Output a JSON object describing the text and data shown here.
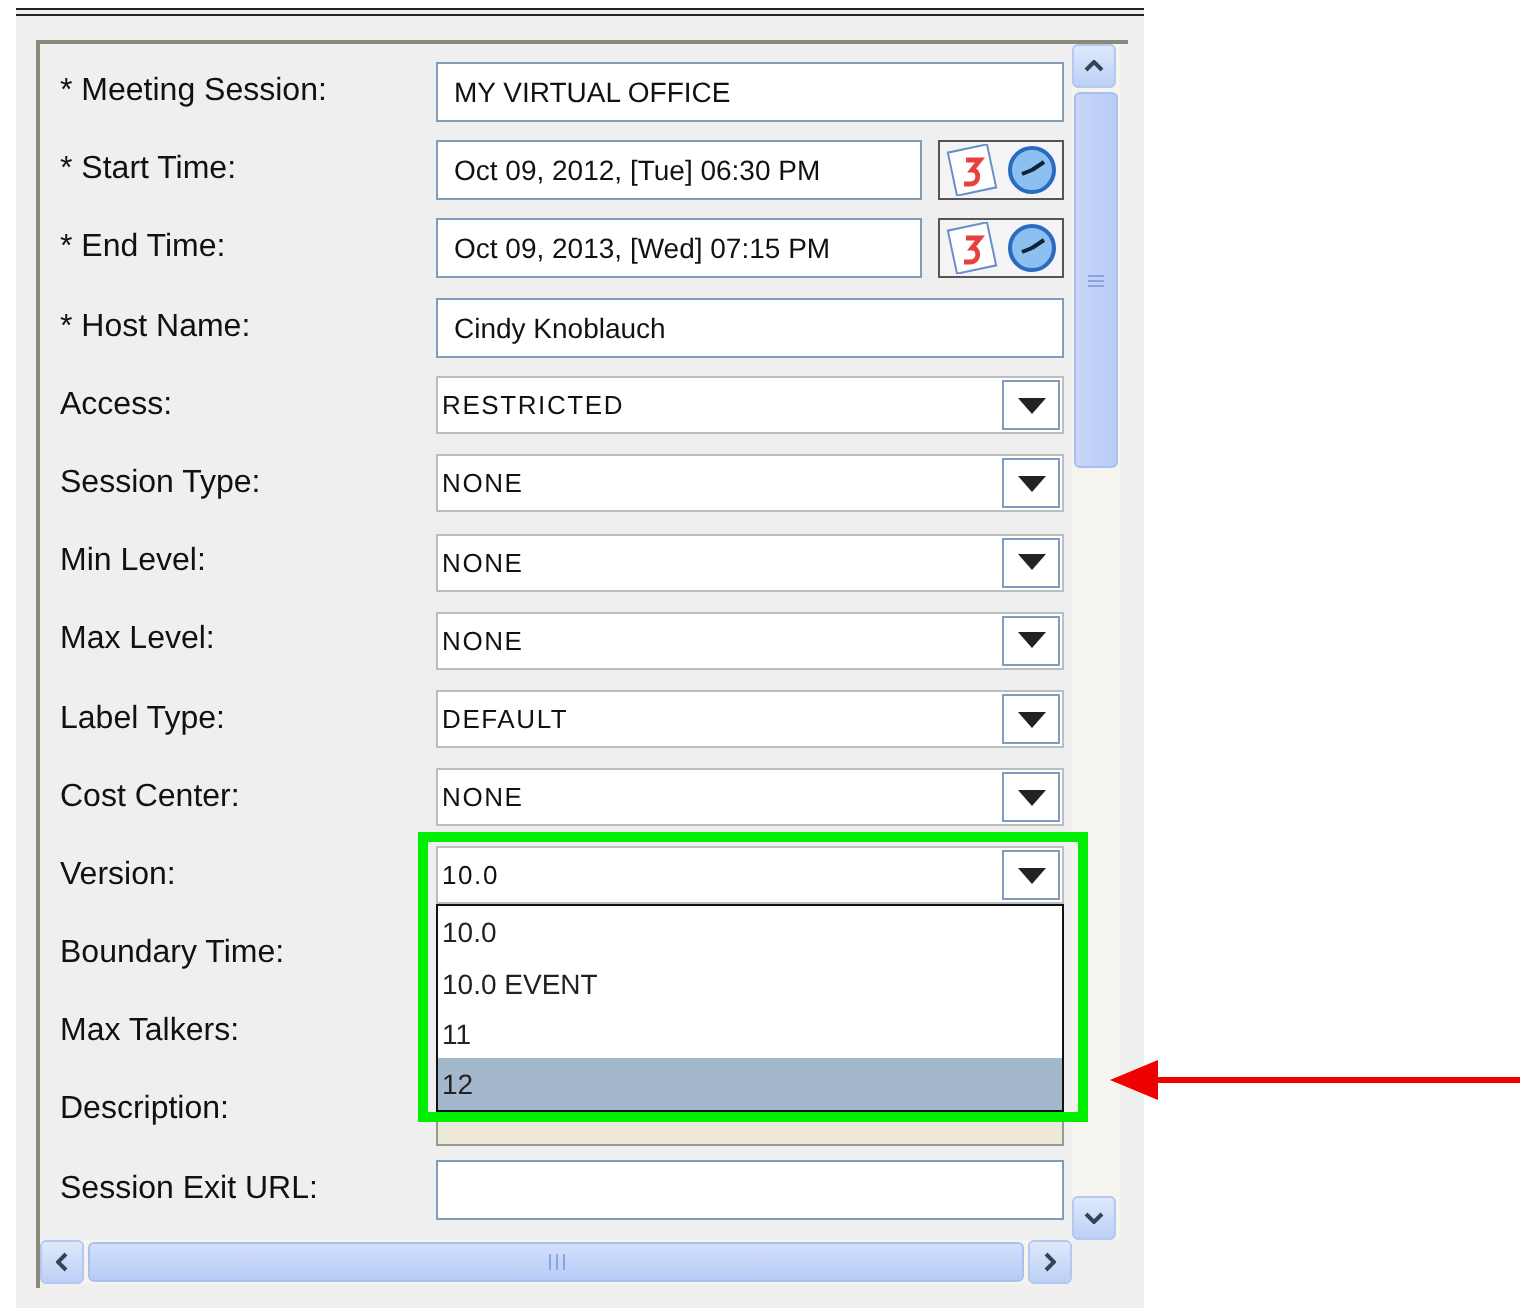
{
  "form": {
    "rows": [
      {
        "label": "* Meeting Session:",
        "kind": "text",
        "value": "MY VIRTUAL OFFICE"
      },
      {
        "label": "* Start Time:",
        "kind": "datetime",
        "value": "Oct 09, 2012, [Tue] 06:30 PM"
      },
      {
        "label": "* End Time:",
        "kind": "datetime",
        "value": "Oct 09, 2013, [Wed] 07:15 PM"
      },
      {
        "label": "* Host Name:",
        "kind": "text",
        "value": "Cindy Knoblauch"
      },
      {
        "label": "Access:",
        "kind": "select",
        "value": "RESTRICTED"
      },
      {
        "label": "Session Type:",
        "kind": "select",
        "value": "NONE"
      },
      {
        "label": "Min Level:",
        "kind": "select",
        "value": "NONE"
      },
      {
        "label": "Max Level:",
        "kind": "select",
        "value": "NONE"
      },
      {
        "label": "Label Type:",
        "kind": "select",
        "value": "DEFAULT"
      },
      {
        "label": "Cost Center:",
        "kind": "select",
        "value": "NONE"
      },
      {
        "label": "Version:",
        "kind": "select",
        "value": "10.0",
        "expanded": true,
        "options": [
          {
            "label": "10.0",
            "highlighted": false
          },
          {
            "label": "10.0 EVENT",
            "highlighted": false
          },
          {
            "label": "11",
            "highlighted": false
          },
          {
            "label": "12",
            "highlighted": true
          }
        ]
      },
      {
        "label": "Boundary Time:",
        "kind": "covered"
      },
      {
        "label": "Max Talkers:",
        "kind": "covered"
      },
      {
        "label": "Description:",
        "kind": "button"
      },
      {
        "label": "Session Exit URL:",
        "kind": "text",
        "value": ""
      }
    ]
  }
}
